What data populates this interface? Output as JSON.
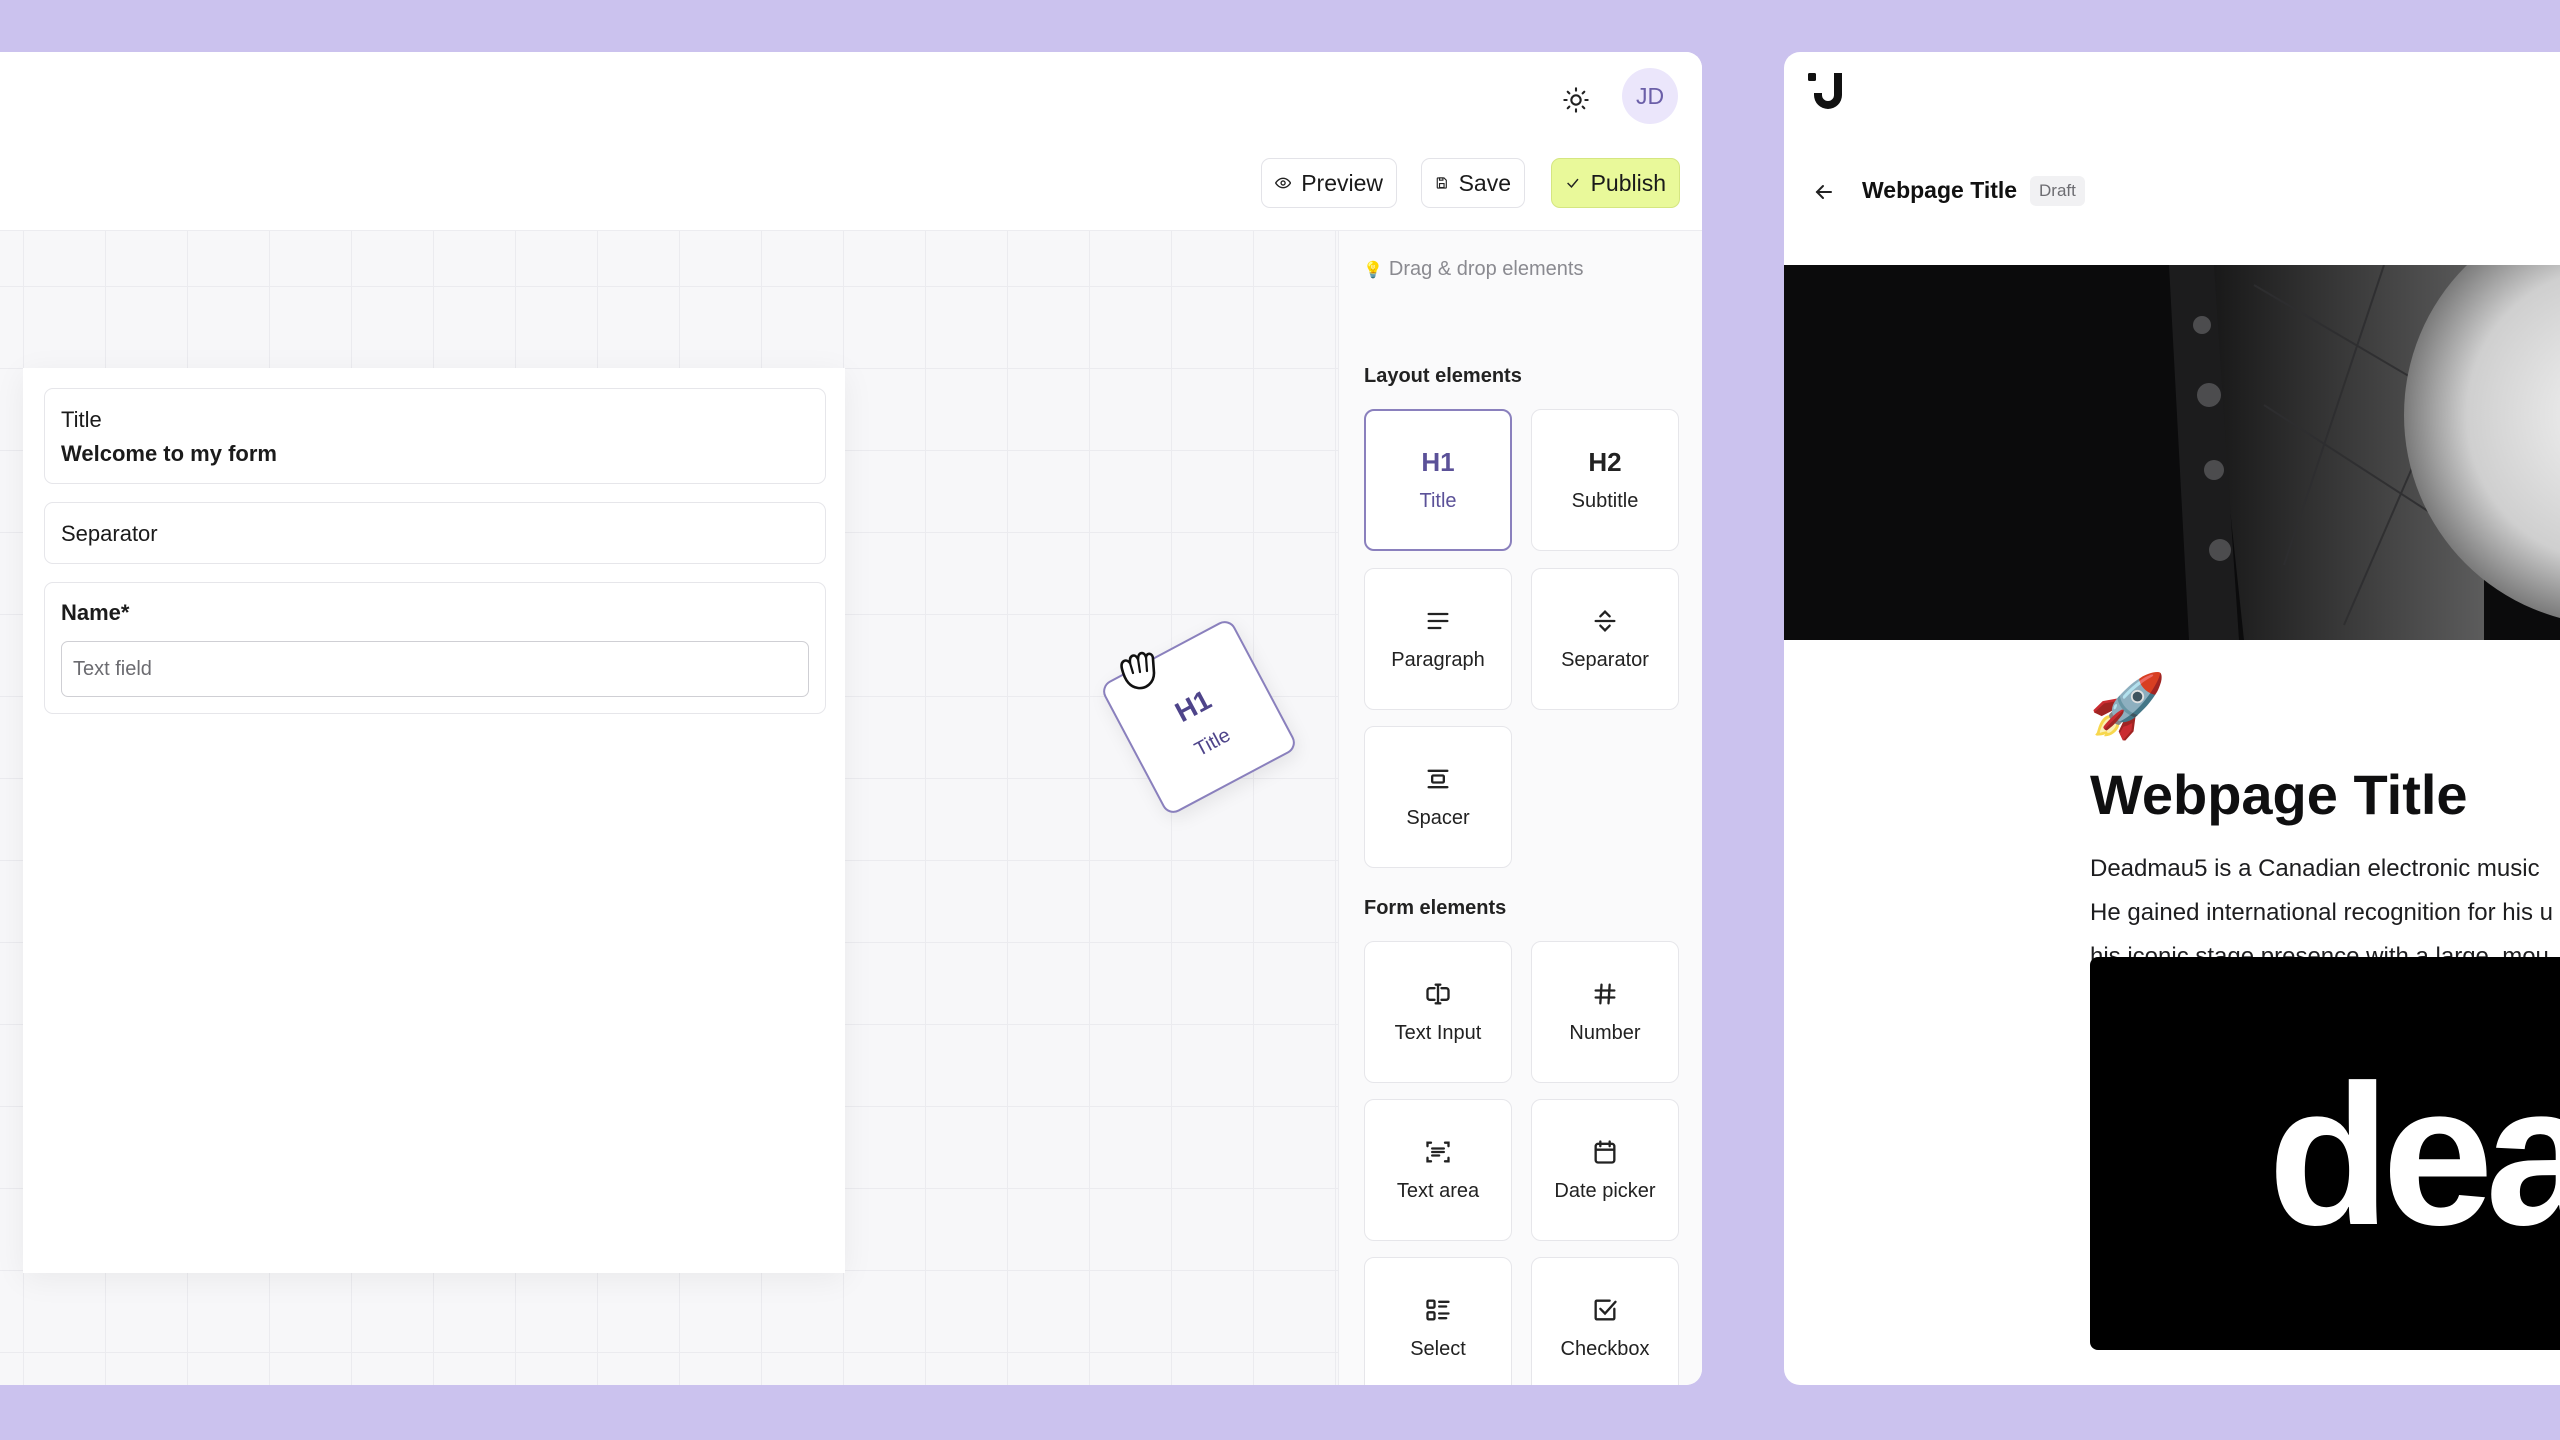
{
  "toolbar": {
    "avatar_initials": "JD",
    "preview_label": "Preview",
    "save_label": "Save",
    "publish_label": "Publish"
  },
  "form": {
    "title_block": {
      "label": "Title",
      "value": "Welcome to my form"
    },
    "separator_block": {
      "label": "Separator"
    },
    "name_block": {
      "label": "Name*",
      "placeholder": "Text field"
    }
  },
  "drag_ghost": {
    "heading": "H1",
    "label": "Title"
  },
  "palette": {
    "hint": "Drag & drop elements",
    "layout_title": "Layout elements",
    "layout_items": [
      {
        "big": "H1",
        "label": "Title"
      },
      {
        "big": "H2",
        "label": "Subtitle"
      },
      {
        "label": "Paragraph",
        "icon": "paragraph-icon"
      },
      {
        "label": "Separator",
        "icon": "separator-icon"
      },
      {
        "label": "Spacer",
        "icon": "spacer-icon"
      }
    ],
    "form_title": "Form elements",
    "form_items": [
      {
        "label": "Text Input",
        "icon": "text-input-icon"
      },
      {
        "label": "Number",
        "icon": "hash-icon"
      },
      {
        "label": "Text area",
        "icon": "text-area-icon"
      },
      {
        "label": "Date picker",
        "icon": "calendar-icon"
      },
      {
        "label": "Select",
        "icon": "list-icon"
      },
      {
        "label": "Checkbox",
        "icon": "checkbox-icon"
      }
    ]
  },
  "preview": {
    "title": "Webpage Title",
    "badge": "Draft",
    "emoji": "🚀",
    "heading": "Webpage Title",
    "paragraph_lines": [
      "Deadmau5 is a Canadian electronic music",
      "He gained international recognition for his u",
      "his iconic stage presence with a large, mou"
    ],
    "video_text": "dea"
  },
  "colors": {
    "background": "#cbc2ee",
    "publish": "#e9f99a",
    "accent": "#5b5198"
  }
}
